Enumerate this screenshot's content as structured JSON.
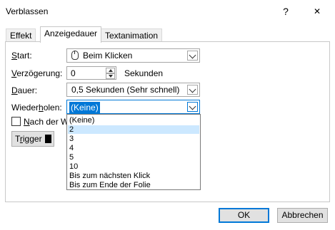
{
  "window": {
    "title": "Verblassen",
    "help_glyph": "?",
    "close_glyph": "✕"
  },
  "tabs": [
    {
      "label": "Effekt"
    },
    {
      "label": "Anzeigedauer"
    },
    {
      "label": "Textanimation"
    }
  ],
  "fields": {
    "start": {
      "label_u": "S",
      "label_rest": "tart:",
      "value": "Beim Klicken"
    },
    "delay": {
      "label_u": "V",
      "label_rest": "erzögerung:",
      "value": "0",
      "unit": "Sekunden"
    },
    "duration": {
      "label_u": "D",
      "label_rest": "auer:",
      "value": "0,5 Sekunden (Sehr schnell)"
    },
    "repeat": {
      "label_pre": "Wieder",
      "label_u": "h",
      "label_rest": "olen:",
      "value": "(Keine)"
    }
  },
  "repeat_options": [
    "(Keine)",
    "2",
    "3",
    "4",
    "5",
    "10",
    "Bis zum nächsten Klick",
    "Bis zum Ende der Folie"
  ],
  "repeat_highlighted_index": 1,
  "after_checkbox": {
    "label_u": "N",
    "label_rest": "ach der Wi",
    "checked": false
  },
  "trigger_button": {
    "label_pre": "T",
    "label_u": "r",
    "label_rest": "igger"
  },
  "footer": {
    "ok_label": "OK",
    "cancel_label": "Abbrechen"
  },
  "colors": {
    "accent": "#0078d7",
    "highlight": "#cce8ff"
  }
}
